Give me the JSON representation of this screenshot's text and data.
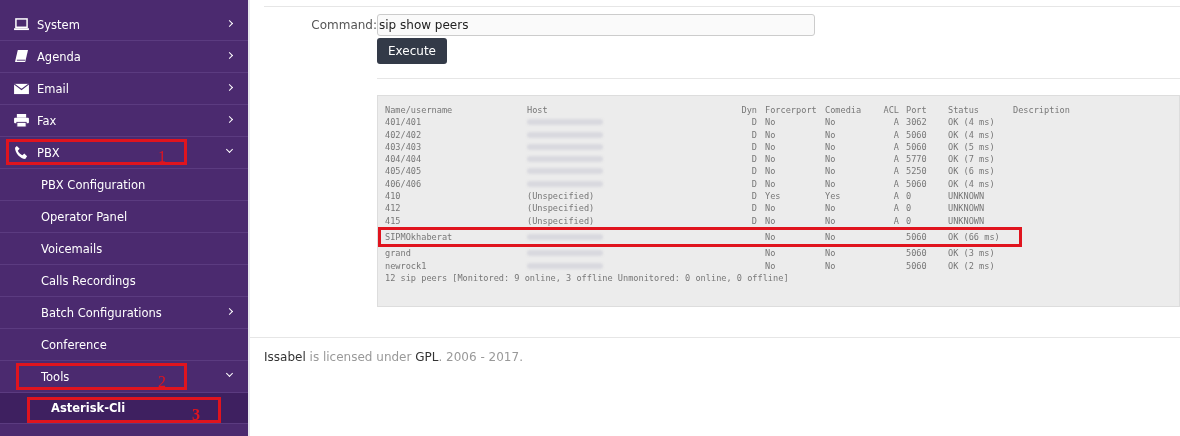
{
  "sidebar": {
    "items": [
      {
        "label": "System",
        "expanded": false
      },
      {
        "label": "Agenda",
        "expanded": false
      },
      {
        "label": "Email",
        "expanded": false
      },
      {
        "label": "Fax",
        "expanded": false
      },
      {
        "label": "PBX",
        "expanded": true,
        "annotation": "1",
        "children": [
          {
            "label": "PBX Configuration",
            "expandable": false,
            "selected": false
          },
          {
            "label": "Operator Panel",
            "expandable": false,
            "selected": false
          },
          {
            "label": "Voicemails",
            "expandable": false,
            "selected": false
          },
          {
            "label": "Calls Recordings",
            "expandable": false,
            "selected": false
          },
          {
            "label": "Batch Configurations",
            "expandable": true,
            "expanded": false,
            "selected": false
          },
          {
            "label": "Conference",
            "expandable": false,
            "selected": false
          },
          {
            "label": "Tools",
            "expandable": true,
            "expanded": true,
            "selected": false,
            "annotation": "2",
            "children": [
              {
                "label": "Asterisk-Cli",
                "selected": true,
                "annotation": "3"
              }
            ]
          }
        ]
      }
    ]
  },
  "command": {
    "label": "Command:",
    "value": "sip show peers",
    "button": "Execute"
  },
  "output": {
    "columns": [
      "Name/username",
      "Host",
      "Dyn",
      "Forcerport",
      "Comedia",
      "ACL",
      "Port",
      "Status",
      "Description"
    ],
    "rows": [
      {
        "name": "401/401",
        "dyn": "D",
        "forcerport": "No",
        "comedia": "No",
        "acl": "A",
        "port": "3062",
        "status": "OK (4 ms)",
        "highlighted": false
      },
      {
        "name": "402/402",
        "dyn": "D",
        "forcerport": "No",
        "comedia": "No",
        "acl": "A",
        "port": "5060",
        "status": "OK (4 ms)",
        "highlighted": false
      },
      {
        "name": "403/403",
        "dyn": "D",
        "forcerport": "No",
        "comedia": "No",
        "acl": "A",
        "port": "5060",
        "status": "OK (5 ms)",
        "highlighted": false
      },
      {
        "name": "404/404",
        "dyn": "D",
        "forcerport": "No",
        "comedia": "No",
        "acl": "A",
        "port": "5770",
        "status": "OK (7 ms)",
        "highlighted": false
      },
      {
        "name": "405/405",
        "dyn": "D",
        "forcerport": "No",
        "comedia": "No",
        "acl": "A",
        "port": "5250",
        "status": "OK (6 ms)",
        "highlighted": false
      },
      {
        "name": "406/406",
        "dyn": "D",
        "forcerport": "No",
        "comedia": "No",
        "acl": "A",
        "port": "5060",
        "status": "OK (4 ms)",
        "highlighted": false
      },
      {
        "name": "410",
        "host": "(Unspecified)",
        "dyn": "D",
        "forcerport": "Yes",
        "comedia": "Yes",
        "acl": "A",
        "port": "0",
        "status": "UNKNOWN",
        "highlighted": false
      },
      {
        "name": "412",
        "host": "(Unspecified)",
        "dyn": "D",
        "forcerport": "No",
        "comedia": "No",
        "acl": "A",
        "port": "0",
        "status": "UNKNOWN",
        "highlighted": false
      },
      {
        "name": "415",
        "host": "(Unspecified)",
        "dyn": "D",
        "forcerport": "No",
        "comedia": "No",
        "acl": "A",
        "port": "0",
        "status": "UNKNOWN",
        "highlighted": false
      },
      {
        "name": "SIPMOkhaberat",
        "forcerport": "No",
        "comedia": "No",
        "port": "5060",
        "status": "OK (66 ms)",
        "highlighted": true
      },
      {
        "name": "grand",
        "forcerport": "No",
        "comedia": "No",
        "port": "5060",
        "status": "OK (3 ms)",
        "highlighted": false
      },
      {
        "name": "newrock1",
        "forcerport": "No",
        "comedia": "No",
        "port": "5060",
        "status": "OK (2 ms)",
        "highlighted": false
      }
    ],
    "summary": "12 sip peers [Monitored: 9 online, 3 offline Unmonitored: 0 online, 0 offline]"
  },
  "footer": "**Issabel** is licensed under **GPL**. 2006 - 2017."
}
